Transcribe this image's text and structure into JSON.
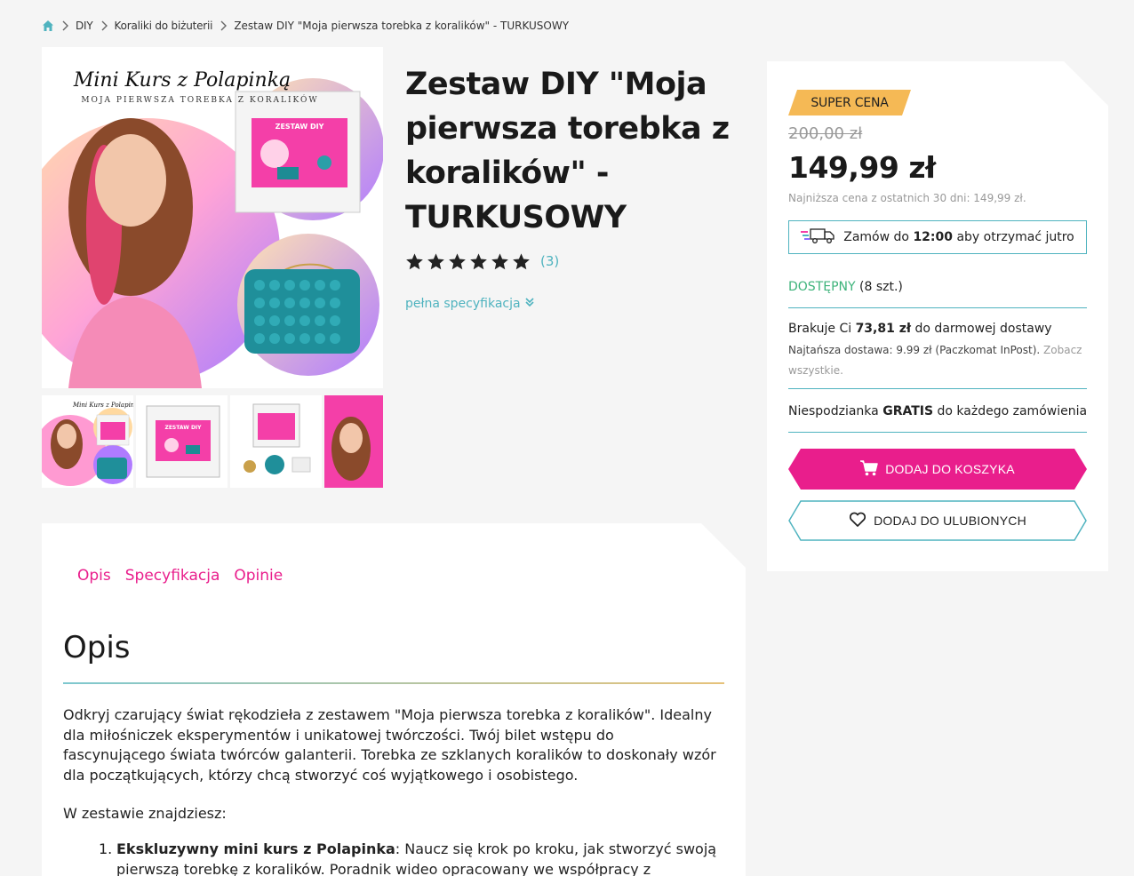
{
  "breadcrumb": {
    "items": [
      "DIY",
      "Koraliki do biżuterii",
      "Zestaw DIY \"Moja pierwsza torebka z koralików\" - TURKUSOWY"
    ]
  },
  "gallery": {
    "main_title": "Mini Kurs z Polapinką",
    "main_subtitle": "MOJA PIERWSZA TOREBKA Z KORALIKÓW",
    "box_label": "ZESTAW DIY",
    "thumb_title": "Mini Kurs z Polapinką",
    "thumb_box_label": "ZESTAW DIY"
  },
  "product": {
    "title_lines": [
      "Zestaw DIY \"Moja",
      "pierwsza torebka z",
      "koralików\" -",
      "TURKUSOWY"
    ],
    "rating_stars": 6,
    "rating_count": "(3)",
    "spec_link": "pełna specyfikacja"
  },
  "buybox": {
    "badge": "SUPER CENA",
    "old_price": "200,00 zł",
    "price": "149,99 zł",
    "lowest_price_note": "Najniższa cena z ostatnich 30 dni: 149,99 zł.",
    "delivery_prefix": "Zamów do",
    "delivery_time": "12:00",
    "delivery_suffix": "aby otrzymać jutro",
    "availability_label": "DOSTĘPNY",
    "availability_count": "(8 szt.)",
    "free_shipping_prefix": "Brakuje Ci",
    "free_shipping_amount": "73,81 zł",
    "free_shipping_suffix": "do darmowej dostawy",
    "cheapest_delivery": "Najtańsza dostawa: 9.99 zł (Paczkomat InPost).",
    "see_all": "Zobacz wszystkie.",
    "surprise_prefix": "Niespodzianka",
    "surprise_bold": "GRATIS",
    "surprise_suffix": "do każdego zamówienia",
    "add_to_cart": "DODAJ DO KOSZYKA",
    "add_to_wishlist": "DODAJ DO ULUBIONYCH"
  },
  "description": {
    "tabs": [
      "Opis",
      "Specyfikacja",
      "Opinie"
    ],
    "heading": "Opis",
    "paragraph": "Odkryj czarujący świat rękodzieła z zestawem \"Moja pierwsza torebka z koralików\". Idealny dla miłośniczek eksperymentów i unikatowej twórczości. Twój bilet wstępu do fascynującego świata twórców galanterii. Torebka ze szklanych koralików to doskonały wzór dla początkujących, którzy chcą stworzyć coś wyjątkowego i osobistego.",
    "kit_intro": "W zestawie znajdziesz:",
    "list_item_1_bold": "Ekskluzywny mini kurs z Polapinka",
    "list_item_1_text": ": Naucz się krok po kroku, jak stworzyć swoją pierwszą torebkę z koralików. Poradnik wideo opracowany we współpracy z influencerką i"
  },
  "colors": {
    "accent_pink": "#e91e8c",
    "accent_teal": "#4fb3bf",
    "badge_orange": "#f5b955",
    "available_green": "#3db37a"
  }
}
